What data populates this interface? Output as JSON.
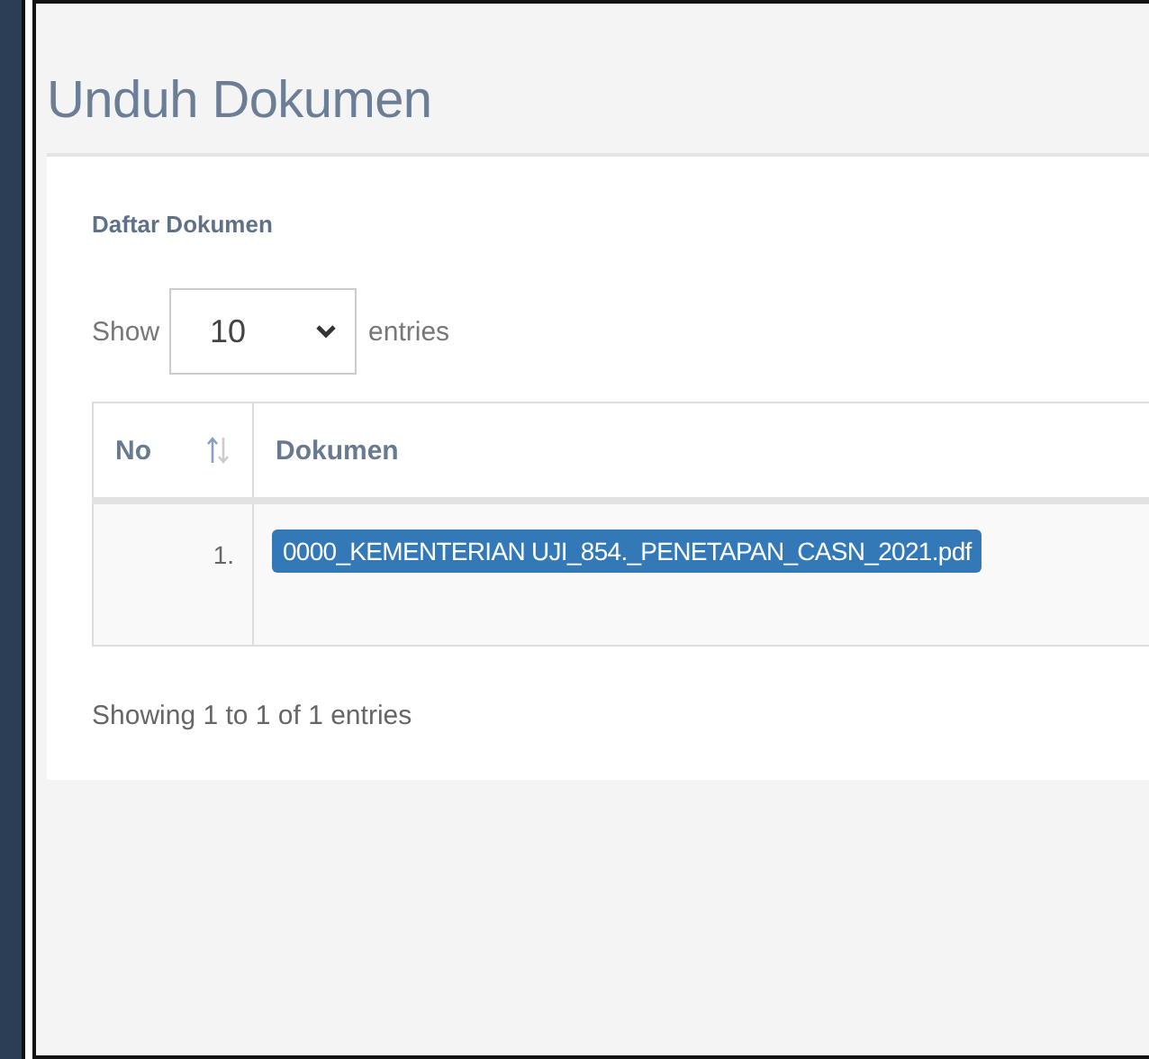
{
  "page": {
    "title": "Unduh Dokumen"
  },
  "box": {
    "title": "Daftar Dokumen",
    "length_menu": {
      "before": "Show",
      "value": "10",
      "after": "entries"
    },
    "table": {
      "columns": [
        {
          "label": "No",
          "sortable": true
        },
        {
          "label": "Dokumen"
        }
      ],
      "rows": [
        {
          "no": "1.",
          "file": "0000_KEMENTERIAN UJI_854._PENETAPAN_CASN_2021.pdf"
        }
      ]
    },
    "info": "Showing 1 to 1 of 1 entries"
  }
}
